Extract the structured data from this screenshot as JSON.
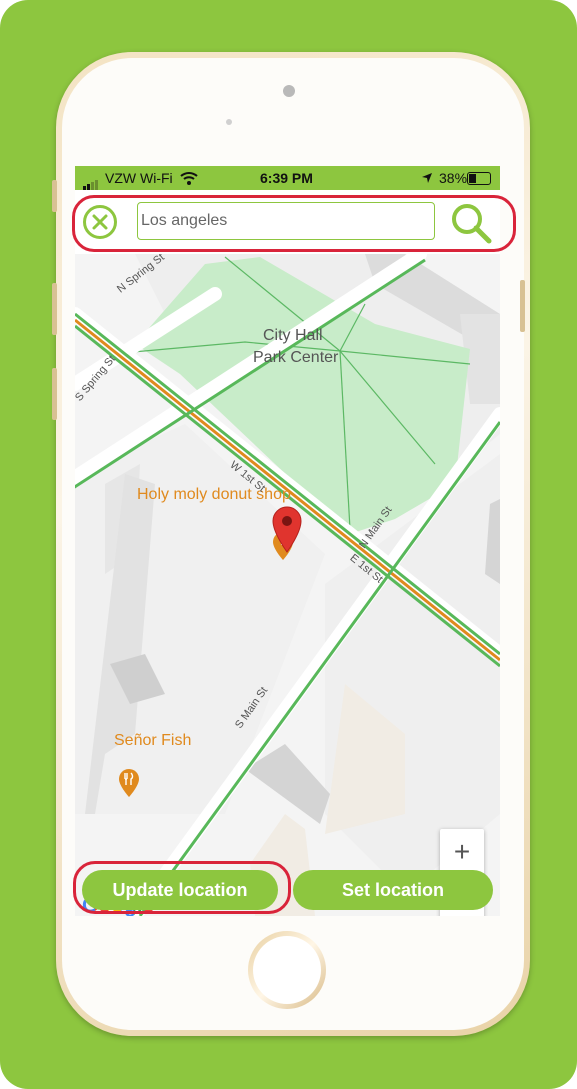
{
  "status_bar": {
    "carrier": "VZW Wi-Fi",
    "time": "6:39 PM",
    "battery": "38%"
  },
  "search": {
    "value": "Los angeles"
  },
  "map": {
    "park_name_line1": "City Hall",
    "park_name_line2": "Park Center",
    "places": [
      {
        "name": "Holy moly donut shop"
      },
      {
        "name": "Señor Fish"
      }
    ],
    "streets": {
      "n_spring": "N Spring St",
      "s_spring": "S Spring St",
      "w_1st": "W 1st St",
      "e_1st": "E 1st St",
      "n_main": "N Main St",
      "s_main": "S Main St"
    },
    "zoom_in": "+",
    "zoom_out": "−",
    "attribution": "Google"
  },
  "buttons": {
    "update_location": "Update location",
    "set_location": "Set location"
  },
  "colors": {
    "accent": "#8dc63f",
    "highlight": "#d9243a",
    "park": "#c8ecc9",
    "poi_orange": "#e08a1e",
    "pin_red": "#e0342e"
  }
}
